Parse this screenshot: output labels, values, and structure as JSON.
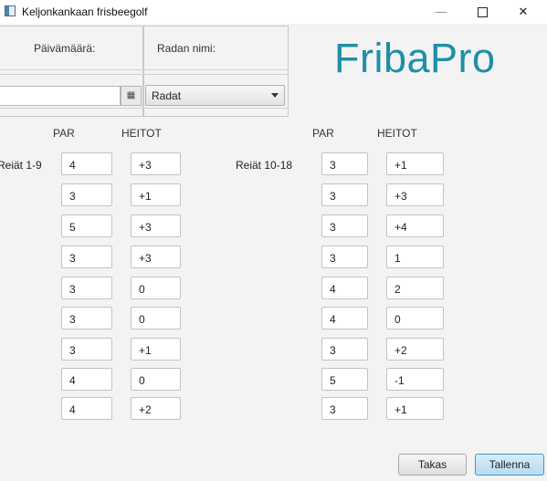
{
  "window": {
    "title": "Keljonkankaan frisbeegolf",
    "minimize_label": "—",
    "close_label": "✕"
  },
  "header": {
    "date_label": "Päivämäärä:",
    "course_label": "Radan nimi:",
    "date_value": "",
    "course_value": "Radat",
    "logo": "FribaPro"
  },
  "columns": {
    "par": "PAR",
    "throws": "HEITOT"
  },
  "left_group": {
    "label": "Reiät 1-9",
    "rows": [
      {
        "par": "4",
        "throws": "+3"
      },
      {
        "par": "3",
        "throws": "+1"
      },
      {
        "par": "5",
        "throws": "+3"
      },
      {
        "par": "3",
        "throws": "+3"
      },
      {
        "par": "3",
        "throws": "0"
      },
      {
        "par": "3",
        "throws": "0"
      },
      {
        "par": "3",
        "throws": "+1"
      },
      {
        "par": "4",
        "throws": "0"
      },
      {
        "par": "4",
        "throws": "+2"
      }
    ]
  },
  "right_group": {
    "label": "Reiät 10-18",
    "rows": [
      {
        "par": "3",
        "throws": "+1"
      },
      {
        "par": "3",
        "throws": "+3"
      },
      {
        "par": "3",
        "throws": "+4"
      },
      {
        "par": "3",
        "throws": "1"
      },
      {
        "par": "4",
        "throws": "2"
      },
      {
        "par": "4",
        "throws": "0"
      },
      {
        "par": "3",
        "throws": "+2"
      },
      {
        "par": "5",
        "throws": "-1"
      },
      {
        "par": "3",
        "throws": "+1"
      }
    ]
  },
  "buttons": {
    "back": "Takas",
    "save": "Tallenna"
  }
}
